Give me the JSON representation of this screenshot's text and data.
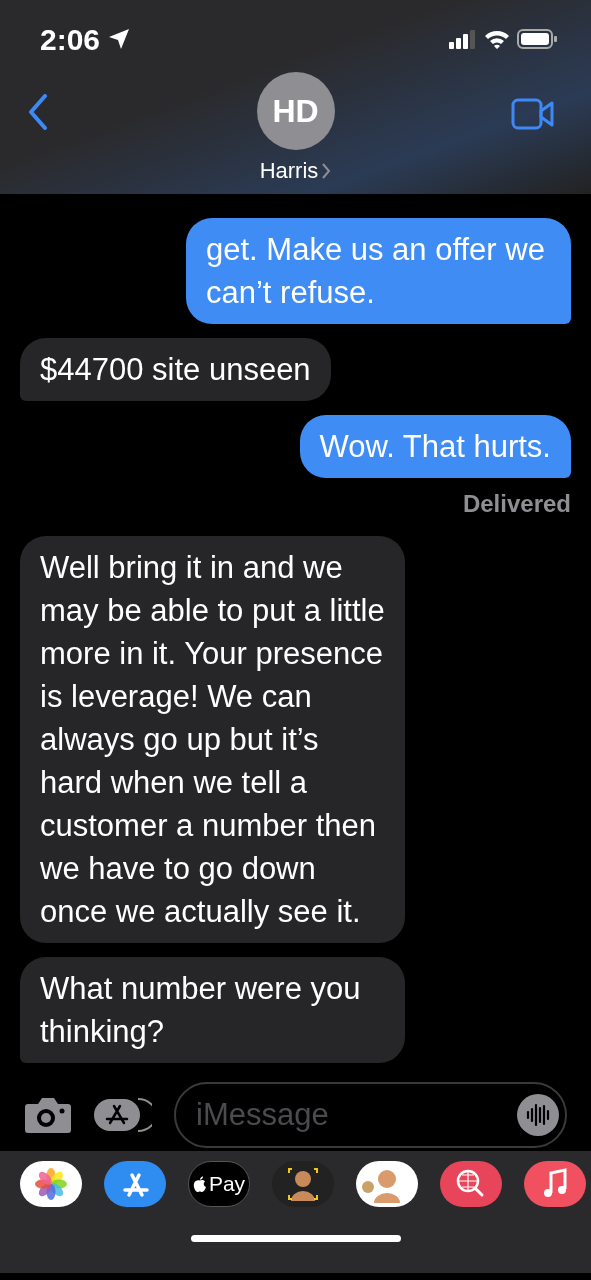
{
  "status_bar": {
    "time": "2:06"
  },
  "header": {
    "initials": "HD",
    "name": "Harris"
  },
  "messages": [
    {
      "kind": "sent",
      "text": "get. Make us an offer we can’t refuse.",
      "tail": true
    },
    {
      "kind": "received",
      "text": "$44700 site unseen",
      "tail": true
    },
    {
      "kind": "sent",
      "text": "Wow. That hurts.",
      "tail": true,
      "status": "Delivered"
    },
    {
      "kind": "received",
      "text": "Well bring it in and we may be able to put a little more in it. Your presence is leverage! We can always go up but it’s hard when we tell a customer a number then we have to go down once we actually see it.",
      "tail": false
    },
    {
      "kind": "received",
      "text": "What number were you thinking?",
      "tail": true
    }
  ],
  "composer": {
    "placeholder": "iMessage"
  },
  "app_drawer": [
    {
      "kind": "photos"
    },
    {
      "kind": "app-store"
    },
    {
      "kind": "apple-pay",
      "label": "Pay"
    },
    {
      "kind": "memoji"
    },
    {
      "kind": "memoji-stickers"
    },
    {
      "kind": "image-search"
    },
    {
      "kind": "music"
    }
  ]
}
